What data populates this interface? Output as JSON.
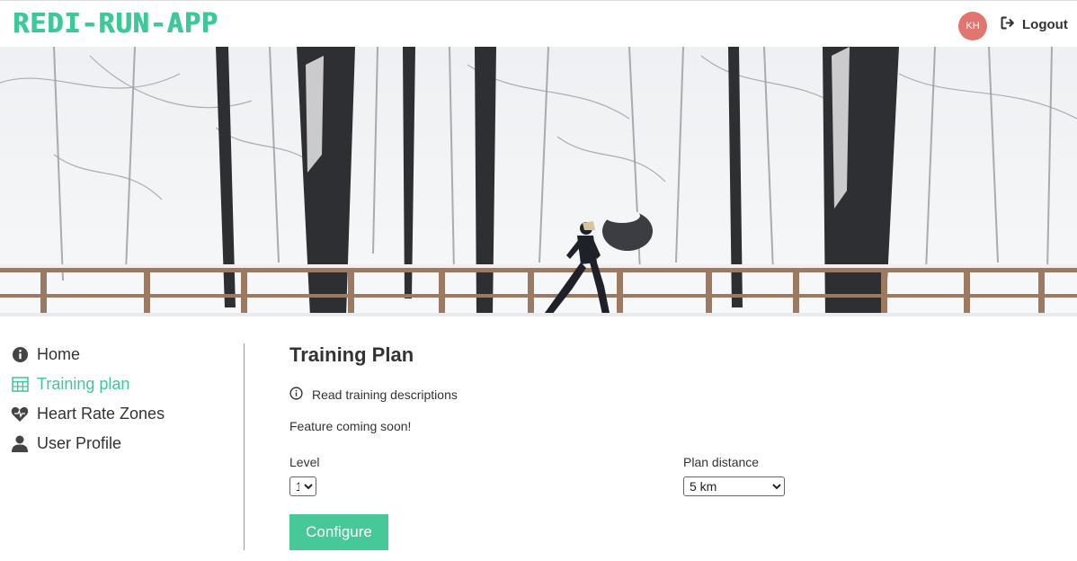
{
  "header": {
    "logo": "REDI-RUN-APP",
    "avatar_initials": "KH",
    "logout_label": "Logout",
    "accent_color": "#3ec896",
    "avatar_color": "#e0766f"
  },
  "hero": {
    "image": "snowy-forest-runner-photo"
  },
  "sidebar": {
    "items": [
      {
        "label": "Home",
        "icon": "info-circle-icon",
        "active": false
      },
      {
        "label": "Training plan",
        "icon": "table-icon",
        "active": true
      },
      {
        "label": "Heart Rate Zones",
        "icon": "heart-icon",
        "active": false
      },
      {
        "label": "User Profile",
        "icon": "user-icon",
        "active": false
      }
    ]
  },
  "main": {
    "title": "Training Plan",
    "read_link": "Read training descriptions",
    "notice": "Feature coming soon!",
    "level": {
      "label": "Level",
      "value": "1"
    },
    "plan_distance": {
      "label": "Plan distance",
      "value": "5 km"
    },
    "configure_label": "Configure"
  }
}
